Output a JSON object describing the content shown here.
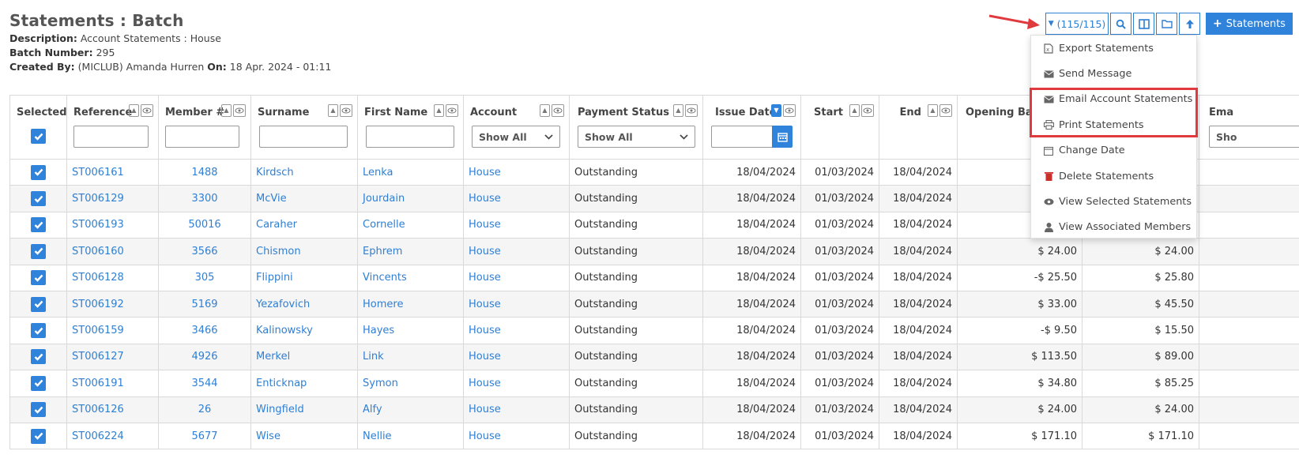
{
  "page": {
    "title": "Statements : Batch",
    "description_label": "Description:",
    "description_value": "Account Statements : House",
    "batch_label": "Batch Number:",
    "batch_value": "295",
    "created_label": "Created By:",
    "created_value": "(MICLUB) Amanda Hurren",
    "on_label": "On:",
    "on_value": "18 Apr. 2024 - 01:11"
  },
  "toolbar": {
    "count_label": "(115/115)",
    "primary_label": "Statements",
    "icons": [
      "caret-down-icon",
      "search-icon",
      "columns-icon",
      "folder-icon",
      "arrow-up-icon",
      "plus-icon"
    ]
  },
  "menu": {
    "items": [
      {
        "label": "Export Statements",
        "icon": "export-file-icon"
      },
      {
        "label": "Send Message",
        "icon": "envelope-icon"
      },
      {
        "label": "Email Account Statements",
        "icon": "envelope-icon"
      },
      {
        "label": "Print Statements",
        "icon": "print-icon"
      },
      {
        "label": "Change Date",
        "icon": "calendar-icon"
      },
      {
        "label": "Delete Statements",
        "icon": "trash-icon"
      },
      {
        "label": "View Selected Statements",
        "icon": "eye-icon"
      },
      {
        "label": "View Associated Members",
        "icon": "user-icon"
      }
    ]
  },
  "table": {
    "headers": {
      "selected": "Selected",
      "reference": "Reference",
      "member": "Member #",
      "surname": "Surname",
      "first_name": "First Name",
      "account": "Account",
      "payment_status": "Payment Status",
      "issue_date": "Issue Date",
      "start": "Start",
      "end": "End",
      "opening_balance": "Opening Bala",
      "email": "Ema"
    },
    "filters": {
      "account": "Show All",
      "payment_status": "Show All",
      "email": "Sho"
    },
    "rows": [
      {
        "ref": "ST006161",
        "member": "1488",
        "surname": "Kirdsch",
        "first": "Lenka",
        "account": "House",
        "status": "Outstanding",
        "issue": "18/04/2024",
        "start": "01/03/2024",
        "end": "18/04/2024",
        "opening": "",
        "closing": ""
      },
      {
        "ref": "ST006129",
        "member": "3300",
        "surname": "McVie",
        "first": "Jourdain",
        "account": "House",
        "status": "Outstanding",
        "issue": "18/04/2024",
        "start": "01/03/2024",
        "end": "18/04/2024",
        "opening": "",
        "closing": ""
      },
      {
        "ref": "ST006193",
        "member": "50016",
        "surname": "Caraher",
        "first": "Cornelle",
        "account": "House",
        "status": "Outstanding",
        "issue": "18/04/2024",
        "start": "01/03/2024",
        "end": "18/04/2024",
        "opening": "",
        "closing": ""
      },
      {
        "ref": "ST006160",
        "member": "3566",
        "surname": "Chismon",
        "first": "Ephrem",
        "account": "House",
        "status": "Outstanding",
        "issue": "18/04/2024",
        "start": "01/03/2024",
        "end": "18/04/2024",
        "opening": "$ 24.00",
        "closing": "$ 24.00"
      },
      {
        "ref": "ST006128",
        "member": "305",
        "surname": "Flippini",
        "first": "Vincents",
        "account": "House",
        "status": "Outstanding",
        "issue": "18/04/2024",
        "start": "01/03/2024",
        "end": "18/04/2024",
        "opening": "-$ 25.50",
        "closing": "$ 25.80"
      },
      {
        "ref": "ST006192",
        "member": "5169",
        "surname": "Yezafovich",
        "first": "Homere",
        "account": "House",
        "status": "Outstanding",
        "issue": "18/04/2024",
        "start": "01/03/2024",
        "end": "18/04/2024",
        "opening": "$ 33.00",
        "closing": "$ 45.50"
      },
      {
        "ref": "ST006159",
        "member": "3466",
        "surname": "Kalinowsky",
        "first": "Hayes",
        "account": "House",
        "status": "Outstanding",
        "issue": "18/04/2024",
        "start": "01/03/2024",
        "end": "18/04/2024",
        "opening": "-$ 9.50",
        "closing": "$ 15.50"
      },
      {
        "ref": "ST006127",
        "member": "4926",
        "surname": "Merkel",
        "first": "Link",
        "account": "House",
        "status": "Outstanding",
        "issue": "18/04/2024",
        "start": "01/03/2024",
        "end": "18/04/2024",
        "opening": "$ 113.50",
        "closing": "$ 89.00"
      },
      {
        "ref": "ST006191",
        "member": "3544",
        "surname": "Enticknap",
        "first": "Symon",
        "account": "House",
        "status": "Outstanding",
        "issue": "18/04/2024",
        "start": "01/03/2024",
        "end": "18/04/2024",
        "opening": "$ 34.80",
        "closing": "$ 85.25"
      },
      {
        "ref": "ST006126",
        "member": "26",
        "surname": "Wingfield",
        "first": "Alfy",
        "account": "House",
        "status": "Outstanding",
        "issue": "18/04/2024",
        "start": "01/03/2024",
        "end": "18/04/2024",
        "opening": "$ 24.00",
        "closing": "$ 24.00"
      },
      {
        "ref": "ST006224",
        "member": "5677",
        "surname": "Wise",
        "first": "Nellie",
        "account": "House",
        "status": "Outstanding",
        "issue": "18/04/2024",
        "start": "01/03/2024",
        "end": "18/04/2024",
        "opening": "$ 171.10",
        "closing": "$ 171.10"
      }
    ]
  },
  "colors": {
    "accent": "#2f83db",
    "link": "#2f7fd2",
    "annotation": "#e0393e"
  }
}
